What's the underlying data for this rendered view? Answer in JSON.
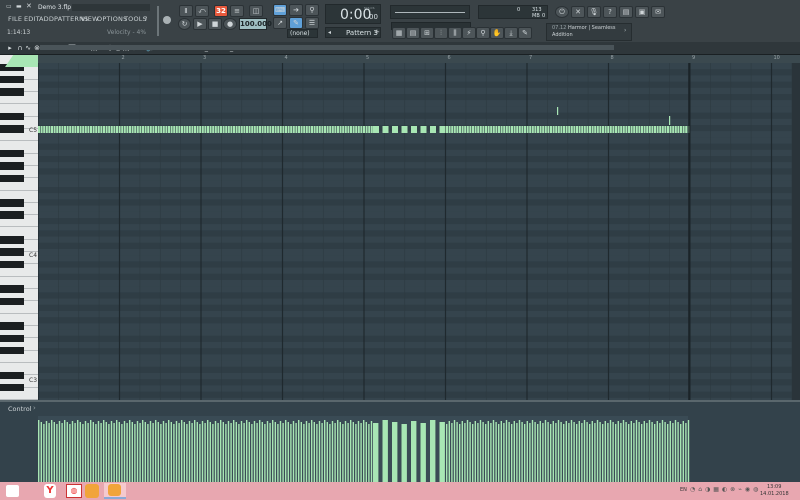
{
  "app": {
    "project_title": "Demo 3.flp",
    "time_code": "1:14:13",
    "velocity_hint": "Velocity - 4%",
    "menu": [
      "FILE",
      "EDIT",
      "ADD",
      "PATTERNS",
      "VIEW",
      "OPTIONS",
      "TOOLS",
      "?"
    ]
  },
  "transport": {
    "pattern_song_toggle": "Ⅱ",
    "tempo": "100.000",
    "song_time": "0:00",
    "song_time_sub": "00",
    "song_time_unit": "M:S:CS",
    "snap": "(none)",
    "pattern_name": "Pattern 3",
    "cpu_value": "0",
    "memory": "313 MB",
    "memory_sub": "0"
  },
  "hint_panel": {
    "line1": "07.12 · Harmor | Seamless Addition",
    "date_code": "07.12",
    "plugin": "Harmor | Seamless",
    "plugin_line2": "Addition"
  },
  "piano_roll": {
    "title": "Piano roll - Hat_Closed_07",
    "ruler_bars": [
      "2",
      "3",
      "4",
      "5",
      "6",
      "7",
      "8",
      "9",
      "10"
    ],
    "key_labels": [
      "C5",
      "C4",
      "C3"
    ]
  },
  "control": {
    "label": "Control",
    "arrow": "›"
  },
  "taskbar": {
    "lang": "EN",
    "time": "13:09",
    "date": "14.01.2018"
  },
  "colors": {
    "note_fill": "#a8e6b4",
    "grid_bg": "#35444d",
    "accent_red": "#e8593c",
    "taskbar_bg": "#e8a7b0"
  }
}
